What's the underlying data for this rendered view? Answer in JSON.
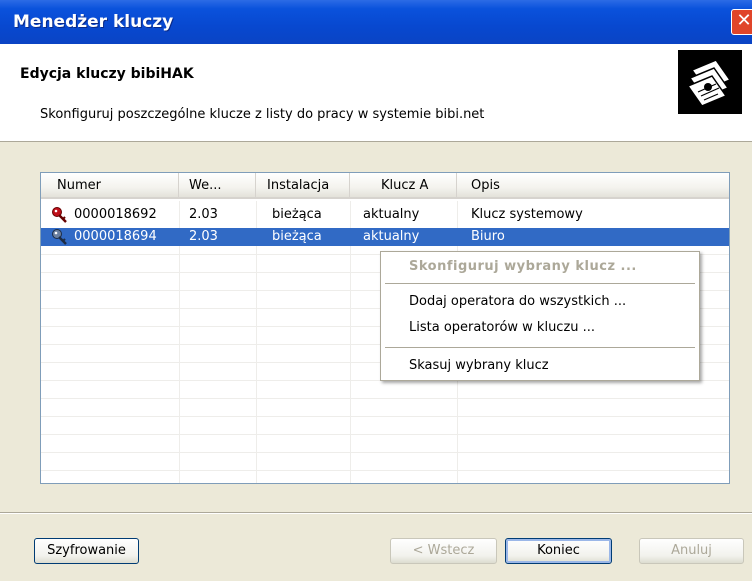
{
  "window": {
    "title": "Menedżer kluczy"
  },
  "header": {
    "title": "Edycja kluczy bibiHAK",
    "subtitle": "Skonfiguruj poszczególne klucze z listy do pracy w systemie bibi.net"
  },
  "list": {
    "columns": [
      "Numer",
      "We...",
      "Instalacja",
      "Klucz A",
      "Opis"
    ],
    "rows": [
      {
        "numer": "0000018692",
        "wersja": "2.03",
        "instalacja": "bieżąca",
        "klucz_a": "aktualny",
        "opis": "Klucz systemowy",
        "icon": "red-key-icon"
      },
      {
        "numer": "0000018694",
        "wersja": "2.03",
        "instalacja": "bieżąca",
        "klucz_a": "aktualny",
        "opis": "Biuro",
        "icon": "gray-key-icon",
        "selected": true
      }
    ]
  },
  "context_menu": {
    "items": [
      {
        "label": "Skonfiguruj wybrany klucz ...",
        "enabled": false
      },
      {
        "label": "Dodaj operatora do wszystkich ...",
        "enabled": true
      },
      {
        "label": "Lista operatorów w kluczu ...",
        "enabled": true
      },
      {
        "label": "Skasuj wybrany klucz",
        "enabled": true
      }
    ]
  },
  "buttons": {
    "encrypt": "Szyfrowanie",
    "back": "< Wstecz",
    "finish": "Koniec",
    "cancel": "Anuluj"
  },
  "colors": {
    "titlebar": "#0a52dc",
    "selection": "#316ac5",
    "close": "#e0452a"
  }
}
